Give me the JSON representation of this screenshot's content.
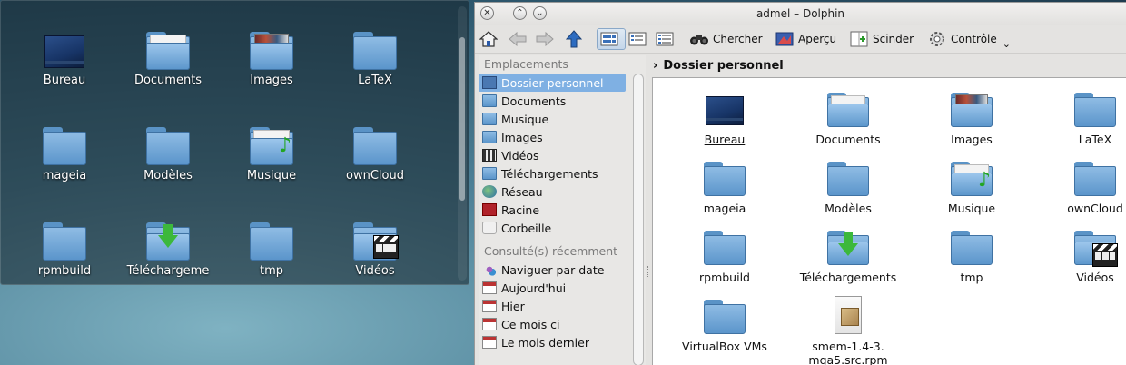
{
  "desktop": {
    "items": [
      {
        "label": "Bureau",
        "icon": "desktop-folder-icon"
      },
      {
        "label": "Documents",
        "icon": "documents-folder-icon"
      },
      {
        "label": "Images",
        "icon": "images-folder-icon"
      },
      {
        "label": "LaTeX",
        "icon": "folder-icon"
      },
      {
        "label": "mageia",
        "icon": "folder-icon"
      },
      {
        "label": "Modèles",
        "icon": "folder-icon"
      },
      {
        "label": "Musique",
        "icon": "music-folder-icon"
      },
      {
        "label": "ownCloud",
        "icon": "folder-icon"
      },
      {
        "label": "rpmbuild",
        "icon": "folder-icon"
      },
      {
        "label": "Téléchargeme",
        "icon": "downloads-folder-icon"
      },
      {
        "label": "tmp",
        "icon": "folder-icon"
      },
      {
        "label": "Vidéos",
        "icon": "videos-folder-icon"
      }
    ]
  },
  "window": {
    "title": "admel – Dolphin"
  },
  "toolbar": {
    "search_label": "Chercher",
    "preview_label": "Aperçu",
    "split_label": "Scinder",
    "control_label": "Contrôle"
  },
  "places": {
    "header": "Emplacements",
    "items": [
      {
        "label": "Dossier personnel"
      },
      {
        "label": "Documents"
      },
      {
        "label": "Musique"
      },
      {
        "label": "Images"
      },
      {
        "label": "Vidéos"
      },
      {
        "label": "Téléchargements"
      },
      {
        "label": "Réseau"
      },
      {
        "label": "Racine"
      },
      {
        "label": "Corbeille"
      }
    ],
    "recent_header": "Consulté(s) récemment",
    "recent": [
      {
        "label": "Naviguer par date"
      },
      {
        "label": "Aujourd'hui"
      },
      {
        "label": "Hier"
      },
      {
        "label": "Ce mois ci"
      },
      {
        "label": "Le mois dernier"
      }
    ]
  },
  "breadcrumb": {
    "current": "Dossier personnel"
  },
  "files": [
    {
      "label": "Bureau",
      "icon": "desktop-folder-icon"
    },
    {
      "label": "Documents",
      "icon": "documents-folder-icon"
    },
    {
      "label": "Images",
      "icon": "images-folder-icon"
    },
    {
      "label": "LaTeX",
      "icon": "folder-icon"
    },
    {
      "label": "mageia",
      "icon": "folder-icon"
    },
    {
      "label": "Modèles",
      "icon": "folder-icon"
    },
    {
      "label": "Musique",
      "icon": "music-folder-icon"
    },
    {
      "label": "ownCloud",
      "icon": "folder-icon"
    },
    {
      "label": "rpmbuild",
      "icon": "folder-icon"
    },
    {
      "label": "Téléchargements",
      "icon": "downloads-folder-icon"
    },
    {
      "label": "tmp",
      "icon": "folder-icon"
    },
    {
      "label": "Vidéos",
      "icon": "videos-folder-icon"
    },
    {
      "label": "VirtualBox VMs",
      "icon": "folder-icon"
    },
    {
      "label": "smem-1.4-3.\nmga5.src.rpm",
      "icon": "rpm-package-icon"
    }
  ]
}
